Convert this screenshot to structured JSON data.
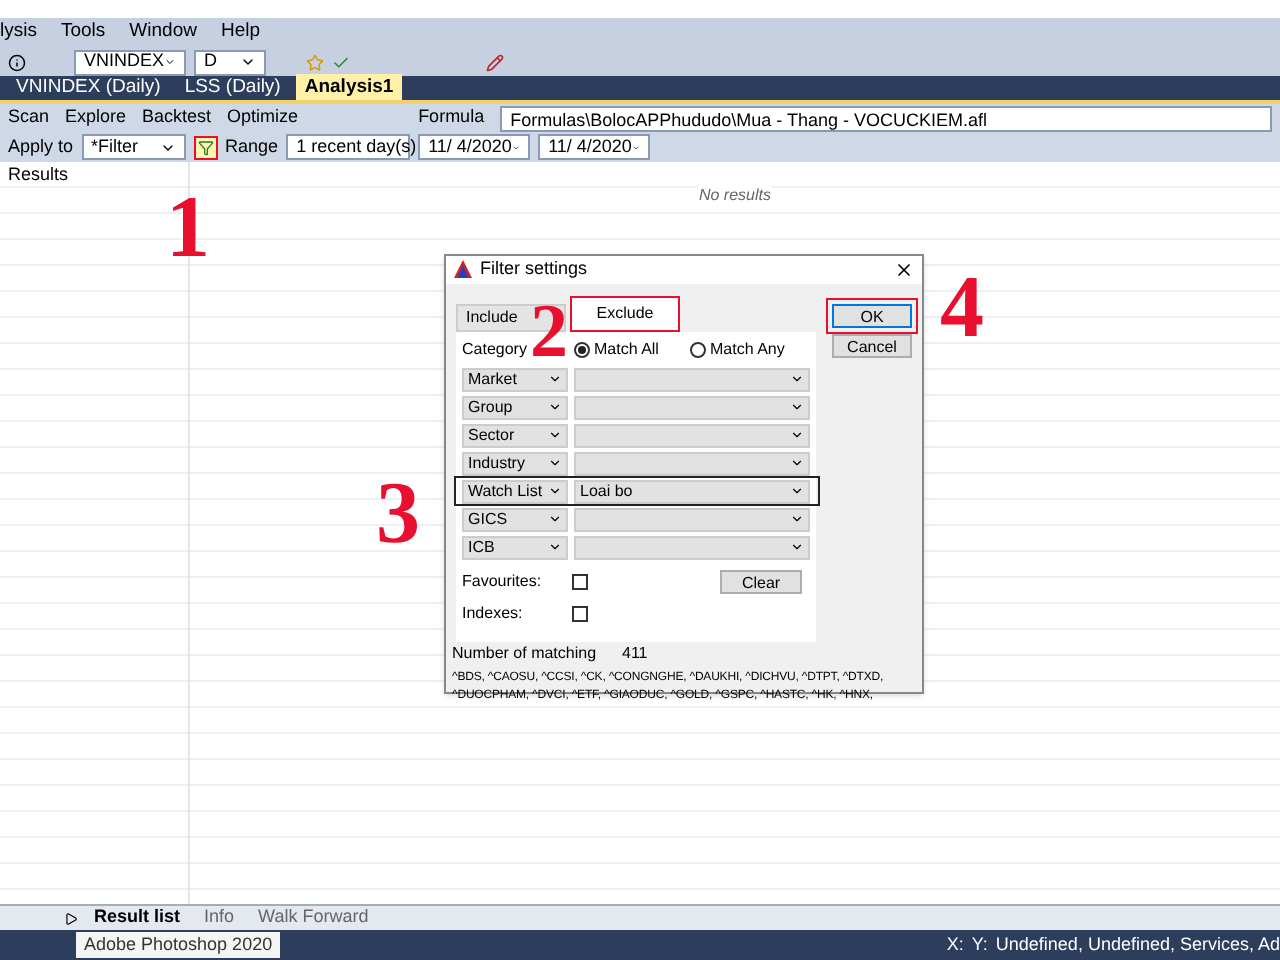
{
  "menu": [
    "lysis",
    "Tools",
    "Window",
    "Help"
  ],
  "toolbar": {
    "symbol": "VNINDEX",
    "interval": "D"
  },
  "doc_tabs": [
    {
      "label": "VNINDEX (Daily)",
      "selected": false
    },
    {
      "label": "LSS (Daily)",
      "selected": false
    },
    {
      "label": "Analysis1",
      "selected": true
    }
  ],
  "analysis_toolbar": {
    "buttons": [
      "Scan",
      "Explore",
      "Backtest",
      "Optimize"
    ],
    "formula_label": "Formula",
    "formula": "Formulas\\BolocAPPhududo\\Mua - Thang - VOCUCKIEM.afl"
  },
  "apply_row": {
    "apply_label": "Apply to",
    "apply_value": "*Filter",
    "range_label": "Range",
    "range_value": "1 recent day(s)",
    "from": "11/  4/2020",
    "to": "11/  4/2020"
  },
  "results": {
    "column": "Results",
    "empty": "No results"
  },
  "dialog": {
    "title": "Filter settings",
    "tabs": [
      {
        "label": "Include",
        "selected": false
      },
      {
        "label": "Exclude",
        "selected": true
      }
    ],
    "category_label": "Category",
    "match": [
      {
        "label": "Match All",
        "selected": true
      },
      {
        "label": "Match Any",
        "selected": false
      }
    ],
    "filters": [
      {
        "name": "Market"
      },
      {
        "name": "Group"
      },
      {
        "name": "Sector"
      },
      {
        "name": "Industry"
      },
      {
        "name": "Watch List",
        "value": "Loai bo"
      },
      {
        "name": "GICS"
      },
      {
        "name": "ICB"
      }
    ],
    "checks": [
      {
        "label": "Favourites:",
        "checked": false
      },
      {
        "label": "Indexes:",
        "checked": false
      }
    ],
    "clear": "Clear",
    "ok": "OK",
    "cancel": "Cancel",
    "matching_label": "Number of matching",
    "matching_count": "411",
    "matching_list": "^BDS, ^CAOSU, ^CCSI, ^CK, ^CONGNGHE, ^DAUKHI, ^DICHVU, ^DTPT, ^DTXD, ^DUOCPHAM, ^DVCI, ^ETF, ^GIAODUC, ^GOLD, ^GSPC, ^HASTC, ^HK, ^HNX,"
  },
  "annotations": [
    "1",
    "2",
    "3",
    "4"
  ],
  "sheet_tabs": [
    {
      "label": "Result list",
      "selected": true
    },
    {
      "label": "Info",
      "selected": false
    },
    {
      "label": "Walk Forward",
      "selected": false
    }
  ],
  "taskbar": {
    "tooltip": "Adobe Photoshop 2020",
    "status": "Undefined, Undefined, Services, Ad",
    "x": "X:",
    "y": "Y:"
  }
}
